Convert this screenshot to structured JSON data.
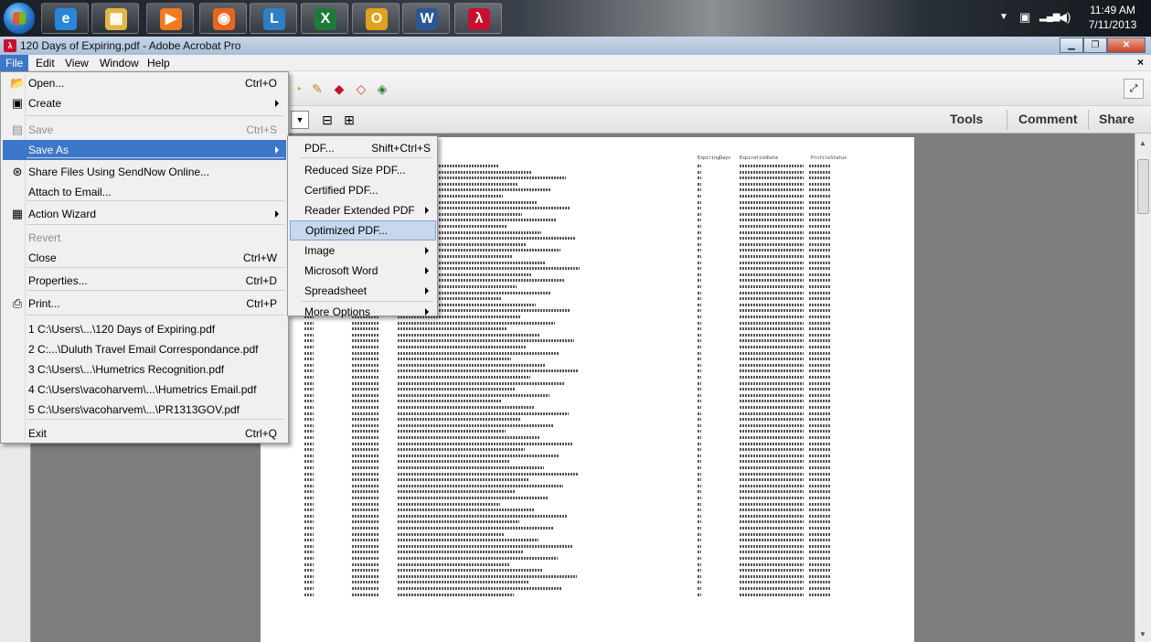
{
  "taskbar": {
    "apps": [
      {
        "icon": "internet-explorer-icon",
        "glyph": "e",
        "color": "#2a86d9"
      },
      {
        "icon": "file-explorer-icon",
        "glyph": "▦",
        "color": "#e3b64a"
      },
      {
        "icon": "media-player-icon",
        "glyph": "▶",
        "color": "#f07b1d"
      },
      {
        "icon": "firefox-icon",
        "glyph": "◉",
        "color": "#e8651f"
      },
      {
        "icon": "lync-icon",
        "glyph": "L",
        "color": "#2d7fc1"
      },
      {
        "icon": "excel-icon",
        "glyph": "X",
        "color": "#1f7a3a"
      },
      {
        "icon": "outlook-icon",
        "glyph": "O",
        "color": "#e0a21a"
      },
      {
        "icon": "word-icon",
        "glyph": "W",
        "color": "#2b5797"
      },
      {
        "icon": "acrobat-icon",
        "glyph": "λ",
        "color": "#c8102e"
      }
    ],
    "time": "11:49 AM",
    "date": "7/11/2013"
  },
  "window": {
    "title": "120 Days of Expiring.pdf - Adobe Acrobat Pro"
  },
  "menubar": [
    "File",
    "Edit",
    "View",
    "Window",
    "Help"
  ],
  "toolbar": {
    "tabs": [
      "Tools",
      "Comment",
      "Share"
    ]
  },
  "file_menu": {
    "items": [
      {
        "label": "Open...",
        "shortcut": "Ctrl+O",
        "icon": "folder-open-icon"
      },
      {
        "label": "Create",
        "shortcut": "",
        "icon": "create-pdf-icon",
        "submenu": true
      },
      {
        "label": "Save",
        "shortcut": "Ctrl+S",
        "icon": "save-icon",
        "disabled": true
      },
      {
        "label": "Save As",
        "shortcut": "",
        "submenu": true,
        "selected": true
      },
      {
        "label": "Share Files Using SendNow Online...",
        "shortcut": "",
        "icon": "share-icon"
      },
      {
        "label": "Attach to Email...",
        "shortcut": ""
      },
      {
        "label": "Action Wizard",
        "shortcut": "",
        "icon": "action-wizard-icon",
        "submenu": true
      },
      {
        "label": "Revert",
        "shortcut": "",
        "disabled": true
      },
      {
        "label": "Close",
        "shortcut": "Ctrl+W"
      },
      {
        "label": "Properties...",
        "shortcut": "Ctrl+D"
      },
      {
        "label": "Print...",
        "shortcut": "Ctrl+P",
        "icon": "print-icon"
      },
      {
        "label": "1 C:\\Users\\...\\120 Days of Expiring.pdf",
        "shortcut": ""
      },
      {
        "label": "2 C:...\\Duluth Travel Email Correspondance.pdf",
        "shortcut": ""
      },
      {
        "label": "3 C:\\Users\\...\\Humetrics Recognition.pdf",
        "shortcut": ""
      },
      {
        "label": "4 C:\\Users\\vacoharvem\\...\\Humetrics Email.pdf",
        "shortcut": ""
      },
      {
        "label": "5 C:\\Users\\vacoharvem\\...\\PR1313GOV.pdf",
        "shortcut": ""
      },
      {
        "label": "Exit",
        "shortcut": "Ctrl+Q"
      }
    ]
  },
  "save_as_menu": {
    "items": [
      {
        "label": "PDF...",
        "shortcut": "Shift+Ctrl+S"
      },
      {
        "label": "Reduced Size PDF...",
        "shortcut": ""
      },
      {
        "label": "Certified PDF...",
        "shortcut": ""
      },
      {
        "label": "Reader Extended PDF",
        "shortcut": "",
        "submenu": true
      },
      {
        "label": "Optimized PDF...",
        "shortcut": "",
        "hover": true
      },
      {
        "label": "Image",
        "shortcut": "",
        "submenu": true
      },
      {
        "label": "Microsoft Word",
        "shortcut": "",
        "submenu": true
      },
      {
        "label": "Spreadsheet",
        "shortcut": "",
        "submenu": true
      },
      {
        "label": "More Options",
        "shortcut": "",
        "submenu": true
      }
    ]
  },
  "document": {
    "headers": [
      "ExpiringDays",
      "ExpirationDate",
      "ProfileStatus"
    ]
  }
}
